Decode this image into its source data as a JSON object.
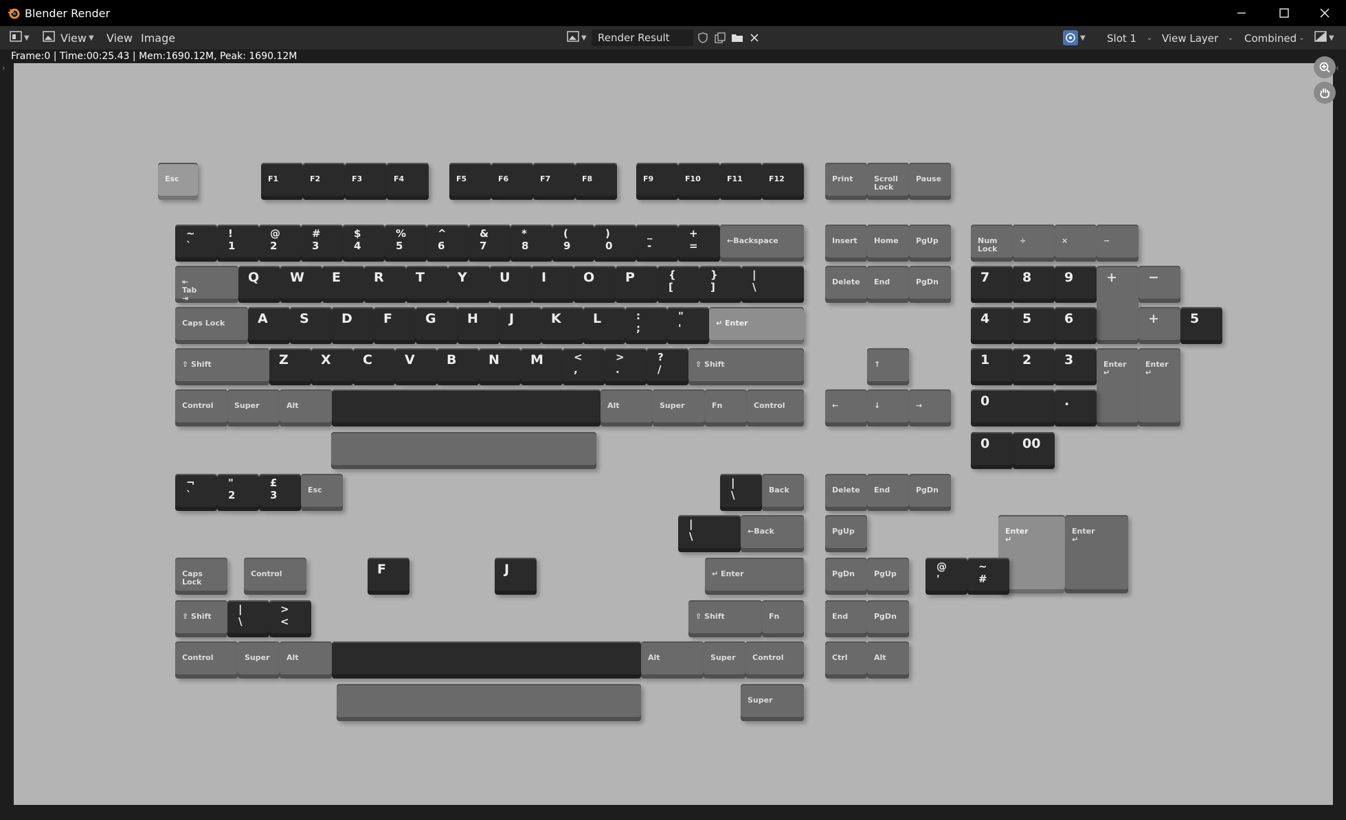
{
  "window": {
    "title": "Blender Render"
  },
  "toolbar": {
    "view_menu": "View",
    "menu_view": "View",
    "menu_image": "Image",
    "image_name": "Render Result",
    "slot": "Slot 1",
    "view_layer": "View Layer",
    "pass": "Combined"
  },
  "status": {
    "text": "Frame:0 | Time:00:25.43 | Mem:1690.12M, Peak: 1690.12M"
  },
  "icons": [
    "blender-logo-icon",
    "minimize-icon",
    "maximize-icon",
    "close-icon",
    "editor-type-icon",
    "image-icon",
    "shield-icon",
    "duplicate-icon",
    "folder-icon",
    "x-icon",
    "display-icon",
    "zoom-icon",
    "hand-icon"
  ],
  "colors": {
    "titlebar": "#000000",
    "toolbar": "#2b2b2b",
    "viewport": "#b4b4b4",
    "key_dark": "#2a2a2a",
    "key_grey": "#6a6a6a"
  },
  "keys": {
    "esc": "Esc",
    "f1": "F1",
    "f2": "F2",
    "f3": "F3",
    "f4": "F4",
    "f5": "F5",
    "f6": "F6",
    "f7": "F7",
    "f8": "F8",
    "f9": "F9",
    "f10": "F10",
    "f11": "F11",
    "f12": "F12",
    "print": "Print",
    "scroll": "Scroll\nLock",
    "pause": "Pause",
    "n_tilde": "~\n`",
    "n1": "!\n1",
    "n2": "@\n2",
    "n3": "#\n3",
    "n4": "$\n4",
    "n5": "%\n5",
    "n6": "^\n6",
    "n7": "&\n7",
    "n8": "*\n8",
    "n9": "(\n9",
    "n0": ")\n0",
    "minus": "_\n-",
    "equal": "+\n=",
    "backspace": "←Backspace",
    "insert": "Insert",
    "home": "Home",
    "pgup": "PgUp",
    "numlock": "Num\nLock",
    "div": "÷",
    "mul": "×",
    "nminus": "−",
    "tab": "⇤\nTab\n⇥",
    "q": "Q",
    "w": "W",
    "e": "E",
    "r": "R",
    "t": "T",
    "y": "Y",
    "u": "U",
    "i": "I",
    "o": "O",
    "p": "P",
    "lbr": "{\n[",
    "rbr": "}\n]",
    "bslash": "|\n\\",
    "delete": "Delete",
    "end": "End",
    "pgdn": "PgDn",
    "k7": "7",
    "k8": "8",
    "k9": "9",
    "kplus": "+",
    "kminus2": "−",
    "caps": "Caps Lock",
    "a": "A",
    "s": "S",
    "d": "D",
    "f": "F",
    "g": "G",
    "h": "H",
    "j": "J",
    "k": "K",
    "l": "L",
    "semi": ":\n;",
    "quote": "\"\n'",
    "enter": "↵ Enter",
    "k4": "4",
    "k5": "5",
    "k6": "6",
    "kplus2": "+",
    "k5b": "5",
    "lshift": "⇧ Shift",
    "z": "Z",
    "x": "X",
    "c": "C",
    "v": "V",
    "b": "B",
    "n": "N",
    "m": "M",
    "comma": "<\n,",
    "period": ">\n.",
    "slash": "?\n/",
    "rshift": "⇧ Shift",
    "up": "↑",
    "k1": "1",
    "k2": "2",
    "k3": "3",
    "kenter": "Enter\n↵",
    "kenter2": "Enter\n↵",
    "lctrl": "Control",
    "lsuper": "Super",
    "lalt": "Alt",
    "ralt": "Alt",
    "rsuper": "Super",
    "fn": "Fn",
    "rctrl": "Control",
    "left": "←",
    "down": "↓",
    "right": "→",
    "k0": "0",
    "kdot": ".",
    "k0b": "0",
    "k00": "00",
    "uk_not": "¬\n`",
    "uk_2": "\"\n2",
    "uk_3": "£\n3",
    "esc2": "Esc",
    "bs_pipe": "|\n\\",
    "back": "Back",
    "delete2": "Delete",
    "end2": "End",
    "pgdn2": "PgDn",
    "bs_pipe2": "|\n\\",
    "back2": "←Back",
    "pgup2": "PgUp",
    "enter_a": "Enter\n↵",
    "enter_b": "Enter\n↵",
    "caps2": "Caps\nLock",
    "control2": "Control",
    "f_home": "F",
    "j_home": "J",
    "enter3": "↵ Enter",
    "pgdn3": "PgDn",
    "pgup3": "PgUp",
    "at": "@\n'",
    "hash": "~\n#",
    "shift2": "⇧ Shift",
    "pipe3": "|\n\\",
    "lt": ">\n<",
    "rshift2": "⇧ Shift",
    "fn2": "Fn",
    "end3": "End",
    "pgdn4": "PgDn",
    "ctrl3": "Control",
    "super3": "Super",
    "alt3": "Alt",
    "alt4": "Alt",
    "super4": "Super",
    "control4": "Control",
    "ctrl_s": "Ctrl",
    "alt_s": "Alt",
    "super5": "Super"
  }
}
